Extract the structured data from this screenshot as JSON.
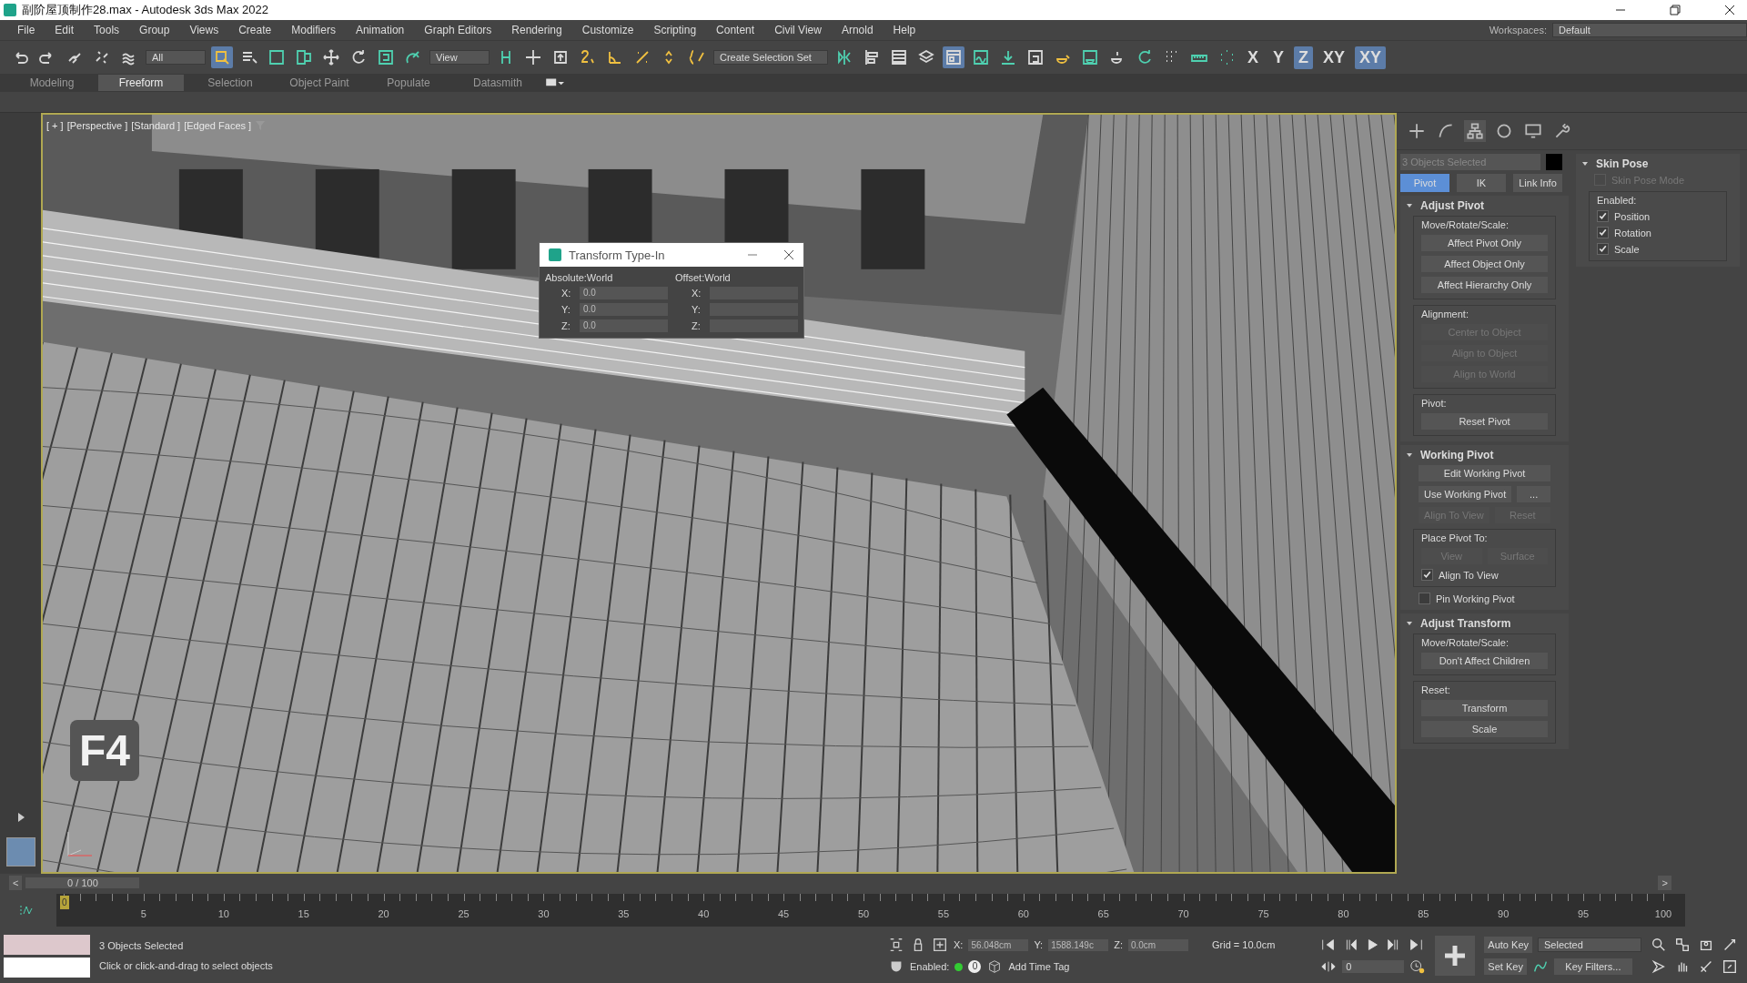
{
  "title_bar": {
    "title": "副阶屋顶制作28.max - Autodesk 3ds Max 2022"
  },
  "menu": [
    "File",
    "Edit",
    "Tools",
    "Group",
    "Views",
    "Create",
    "Modifiers",
    "Animation",
    "Graph Editors",
    "Rendering",
    "Customize",
    "Scripting",
    "Content",
    "Civil View",
    "Arnold",
    "Help"
  ],
  "workspaces": {
    "label": "Workspaces:",
    "value": "Default"
  },
  "toolbar": {
    "selection_filter": "All",
    "reference_coordinate": "View",
    "selection_set": "Create Selection Set",
    "axis_buttons": [
      {
        "label": "X",
        "selected": false
      },
      {
        "label": "Y",
        "selected": false
      },
      {
        "label": "Z",
        "selected": true
      },
      {
        "label": "XY",
        "selected": false
      },
      {
        "label": "XY",
        "selected": true
      }
    ]
  },
  "ribbon_tabs": [
    {
      "label": "Modeling",
      "selected": false
    },
    {
      "label": "Freeform",
      "selected": true
    },
    {
      "label": "Selection",
      "selected": false
    },
    {
      "label": "Object Paint",
      "selected": false
    },
    {
      "label": "Populate",
      "selected": false
    },
    {
      "label": "Datasmith",
      "selected": false
    }
  ],
  "viewport": {
    "labels": [
      "[ + ]",
      "[Perspective ]",
      "[Standard ]",
      "[Edged Faces ]"
    ],
    "key_overlay": "F4"
  },
  "dialog": {
    "title": "Transform Type-In",
    "groups": [
      {
        "title": "Absolute:World",
        "fields": [
          {
            "label": "X:",
            "value": "0.0"
          },
          {
            "label": "Y:",
            "value": "0.0"
          },
          {
            "label": "Z:",
            "value": "0.0"
          }
        ]
      },
      {
        "title": "Offset:World",
        "fields": [
          {
            "label": "X:"
          },
          {
            "label": "Y:"
          },
          {
            "label": "Z:"
          }
        ]
      }
    ]
  },
  "command_panel": {
    "tabs": [
      {
        "selected": false
      },
      {
        "selected": false
      },
      {
        "selected": true
      },
      {
        "selected": false
      },
      {
        "selected": false
      },
      {
        "selected": false
      }
    ],
    "selection_name": {
      "placeholder": "3 Objects Selected"
    },
    "mode_buttons": [
      {
        "label": "Pivot",
        "selected": true
      },
      {
        "label": "IK",
        "selected": false
      },
      {
        "label": "Link Info",
        "selected": false
      }
    ],
    "rollouts": [
      {
        "title": "Adjust Pivot",
        "expanded": true,
        "sections": [
          {
            "kind": "group",
            "title": "Move/Rotate/Scale:",
            "items": [
              {
                "kind": "button",
                "label": "Affect Pivot Only",
                "disabled": false
              },
              {
                "kind": "button",
                "label": "Affect Object Only",
                "disabled": false
              },
              {
                "kind": "button",
                "label": "Affect Hierarchy Only",
                "disabled": false
              }
            ]
          },
          {
            "kind": "group",
            "title": "Alignment:",
            "items": [
              {
                "kind": "button",
                "label": "Center to Object",
                "disabled": true
              },
              {
                "kind": "button",
                "label": "Align to Object",
                "disabled": true
              },
              {
                "kind": "button",
                "label": "Align to World",
                "disabled": true
              }
            ]
          },
          {
            "kind": "group",
            "title": "Pivot:",
            "items": [
              {
                "kind": "button",
                "label": "Reset Pivot",
                "disabled": false
              }
            ]
          }
        ]
      },
      {
        "title": "Working Pivot",
        "expanded": true,
        "sections": [
          {
            "kind": "plain",
            "items": [
              {
                "kind": "button",
                "label": "Edit Working Pivot",
                "disabled": false
              },
              {
                "kind": "pair",
                "buttons": [
                  {
                    "label": "Use Working Pivot",
                    "disabled": false
                  },
                  {
                    "label": "...",
                    "disabled": false
                  }
                ]
              },
              {
                "kind": "pair",
                "buttons": [
                  {
                    "label": "Align To View",
                    "disabled": true
                  },
                  {
                    "label": "Reset",
                    "disabled": true
                  }
                ]
              }
            ]
          },
          {
            "kind": "group",
            "title": "Place Pivot To:",
            "items": [
              {
                "kind": "pair",
                "buttons": [
                  {
                    "label": "View",
                    "disabled": true
                  },
                  {
                    "label": "Surface",
                    "disabled": true
                  }
                ]
              },
              {
                "kind": "checkbox",
                "label": "Align To View",
                "checked": true,
                "disabled": false
              }
            ]
          },
          {
            "kind": "plain",
            "items": [
              {
                "kind": "checkbox",
                "label": "Pin Working Pivot",
                "checked": false,
                "disabled": false
              }
            ]
          }
        ]
      },
      {
        "title": "Adjust Transform",
        "expanded": true,
        "sections": [
          {
            "kind": "group",
            "title": "Move/Rotate/Scale:",
            "items": [
              {
                "kind": "button",
                "label": "Don't Affect Children",
                "disabled": false
              }
            ]
          },
          {
            "kind": "group",
            "title": "Reset:",
            "items": [
              {
                "kind": "button",
                "label": "Transform",
                "disabled": false
              },
              {
                "kind": "button",
                "label": "Scale",
                "disabled": false
              }
            ]
          }
        ]
      }
    ],
    "side_rollout": {
      "title": "Skin Pose",
      "expanded": true,
      "sections": [
        {
          "kind": "plain",
          "items": [
            {
              "kind": "checkbox",
              "label": "Skin Pose Mode",
              "checked": false,
              "disabled": true
            }
          ]
        },
        {
          "kind": "group",
          "title": "Enabled:",
          "items": [
            {
              "kind": "checkbox",
              "label": "Position",
              "checked": true,
              "disabled": false
            },
            {
              "kind": "checkbox",
              "label": "Rotation",
              "checked": true,
              "disabled": false
            },
            {
              "kind": "checkbox",
              "label": "Scale",
              "checked": true,
              "disabled": false
            }
          ]
        }
      ]
    }
  },
  "timeline": {
    "prev": "<",
    "counter": "0 / 100",
    "level": 0,
    "next": ">",
    "current": "0",
    "ticks": [
      "5",
      "10",
      "15",
      "20",
      "25",
      "30",
      "35",
      "40",
      "45",
      "50",
      "55",
      "60",
      "65",
      "70",
      "75",
      "80",
      "85",
      "90",
      "95",
      "100"
    ]
  },
  "status_bar": {
    "selection": "3 Objects Selected",
    "prompt": "Click or click-and-drag to select objects",
    "coords": [
      {
        "label": "X:",
        "value": "56.048cm"
      },
      {
        "label": "Y:",
        "value": "1588.149c"
      },
      {
        "label": "Z:",
        "value": "0.0cm"
      }
    ],
    "grid": "Grid = 10.0cm",
    "enabled_label": "Enabled:",
    "time_tag_count": "0",
    "add_time_tag": "Add Time Tag",
    "frame": "0",
    "auto_key": "Auto Key",
    "key_mode": "Selected",
    "set_key": "Set Key",
    "key_filters": "Key Filters..."
  }
}
